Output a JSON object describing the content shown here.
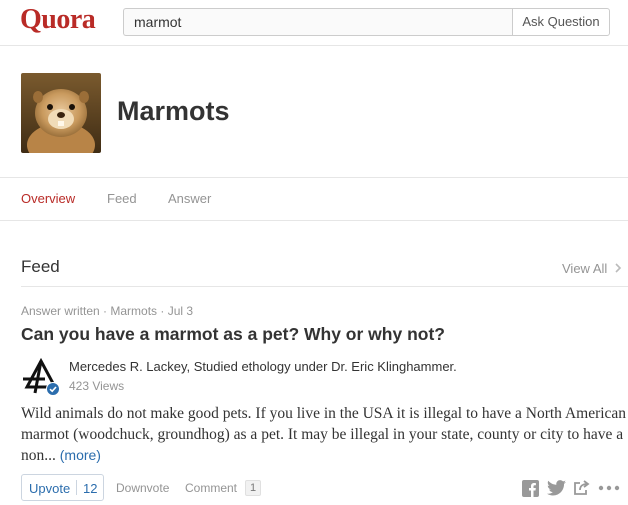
{
  "header": {
    "logo": "Quora",
    "search_value": "marmot",
    "ask_button": "Ask Question"
  },
  "topic": {
    "title": "Marmots",
    "image": "marmot-photo"
  },
  "tabs": [
    {
      "label": "Overview",
      "active": true
    },
    {
      "label": "Feed",
      "active": false
    },
    {
      "label": "Answer",
      "active": false
    }
  ],
  "feed": {
    "title": "Feed",
    "view_all": "View All",
    "item": {
      "meta": "Answer written · Marmots · Jul 3",
      "question": "Can you have a marmot as a pet? Why or why not?",
      "author": "Mercedes R. Lackey, Studied ethology under Dr. Eric Klinghammer.",
      "views": "423 Views",
      "answer_text": "Wild animals do not make good pets. If you live in the USA it is illegal to have a North American marmot (woodchuck, groundhog) as a pet. It may be illegal in your state, county or city to have a non... ",
      "more": "(more)",
      "upvote_label": "Upvote",
      "upvote_count": "12",
      "downvote_label": "Downvote",
      "comment_label": "Comment",
      "comment_count": "1"
    }
  },
  "colors": {
    "brand": "#b92b27",
    "link": "#2b6dad",
    "muted": "#949494"
  },
  "icons": [
    "chevron-right-icon",
    "facebook-icon",
    "twitter-icon",
    "share-icon",
    "more-options-icon",
    "verified-badge-icon"
  ]
}
